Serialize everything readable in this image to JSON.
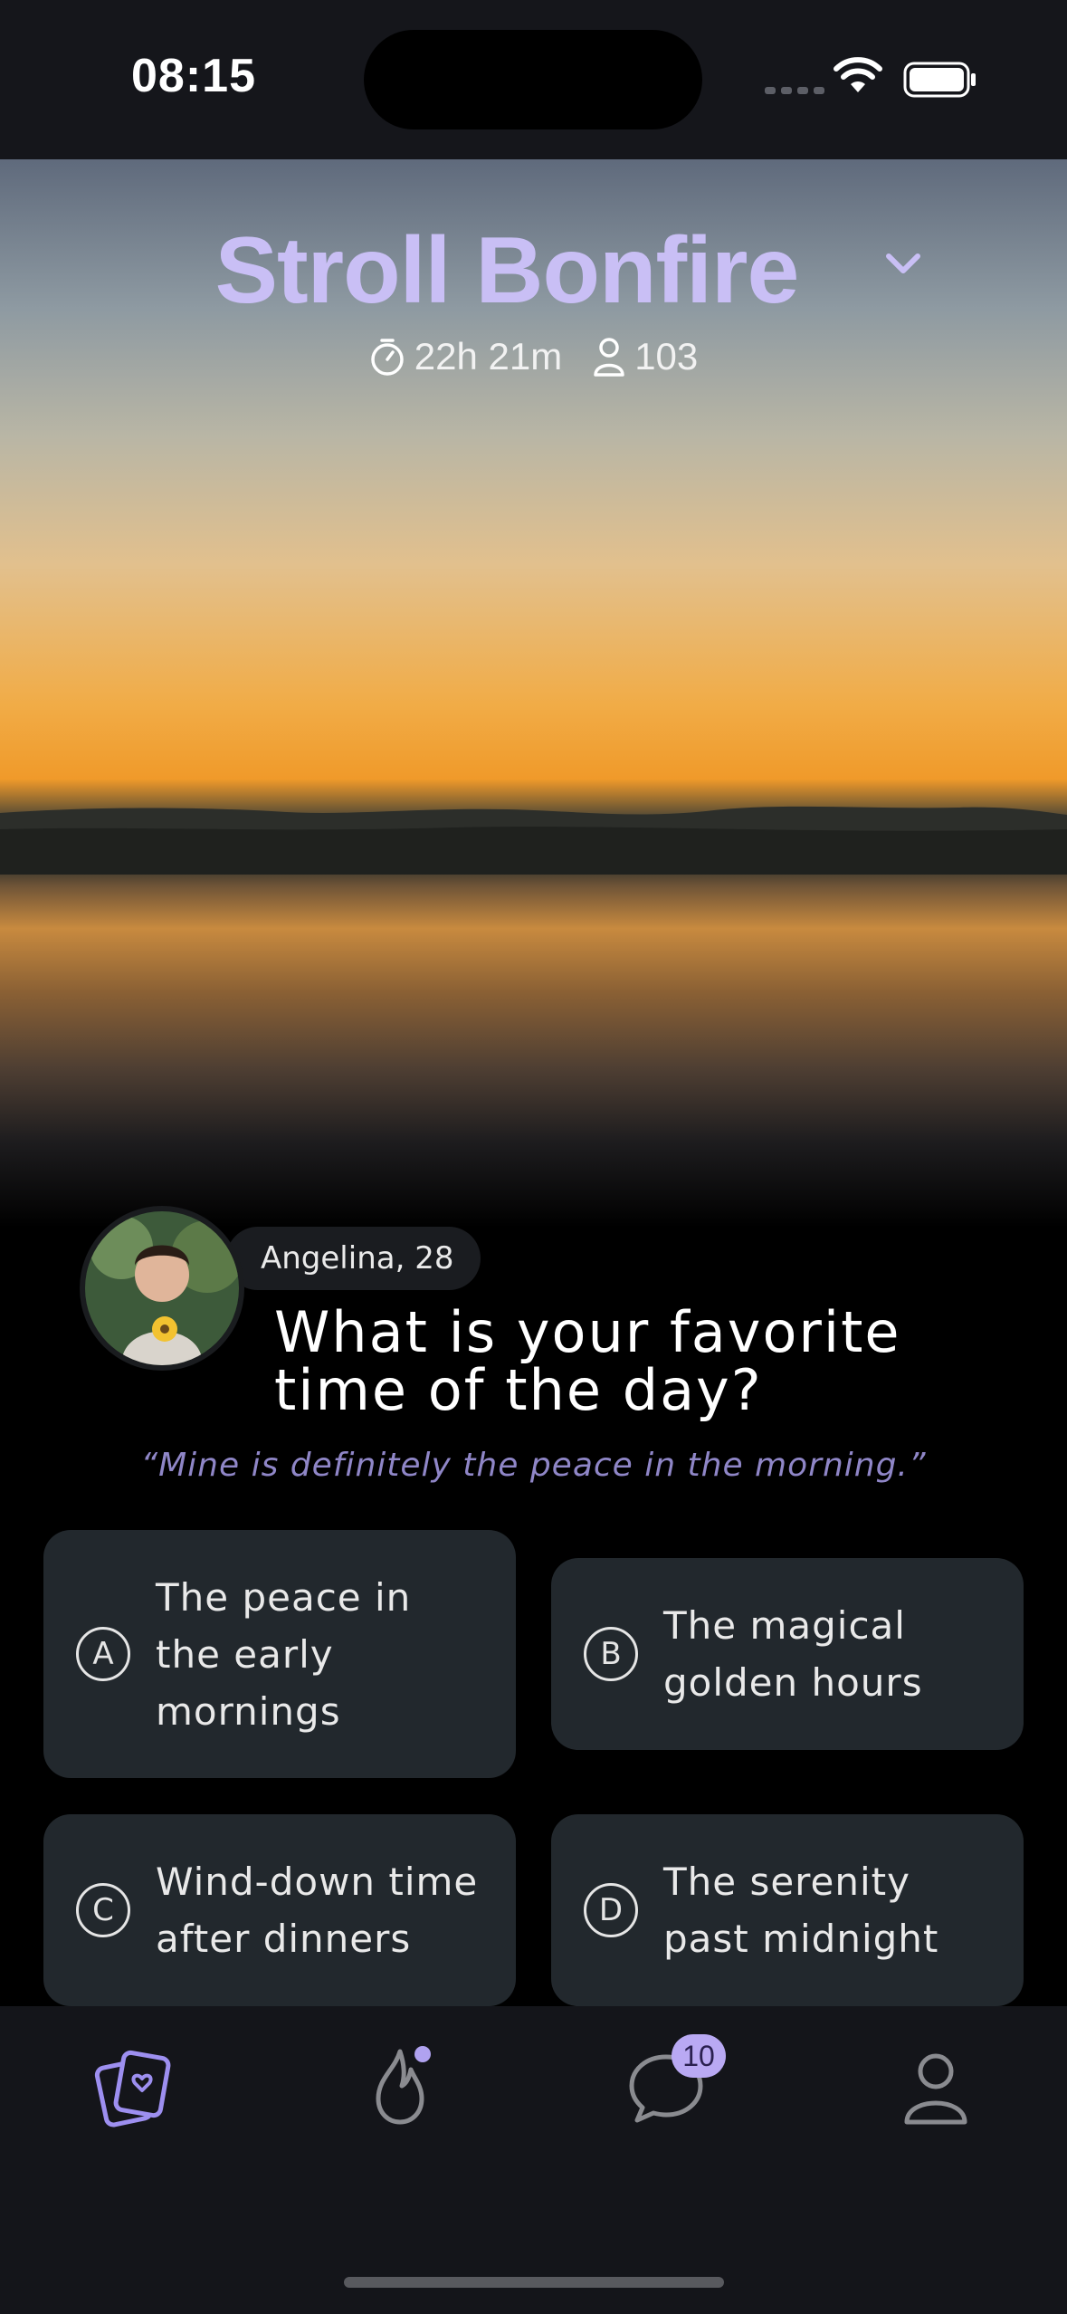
{
  "status_bar": {
    "time": "08:15"
  },
  "header": {
    "title": "Stroll Bonfire",
    "timer": "22h 21m",
    "participants": "103"
  },
  "prompt": {
    "author": "Angelina, 28",
    "question_line1": "What is your favorite",
    "question_line2": "time of the day?",
    "quote": "“Mine is definitely the peace in the morning.”"
  },
  "options": [
    {
      "letter": "A",
      "text": "The peace in the early mornings"
    },
    {
      "letter": "B",
      "text": "The magical golden hours"
    },
    {
      "letter": "C",
      "text": "Wind-down time after dinners"
    },
    {
      "letter": "D",
      "text": "The serenity past midnight"
    }
  ],
  "tabbar": {
    "items": [
      "cards-icon",
      "flame-icon",
      "chat-icon",
      "profile-icon"
    ],
    "chat_badge": "10"
  },
  "colors": {
    "accent": "#b9a9f3",
    "title": "#c9bff5",
    "card": "#22282d"
  }
}
